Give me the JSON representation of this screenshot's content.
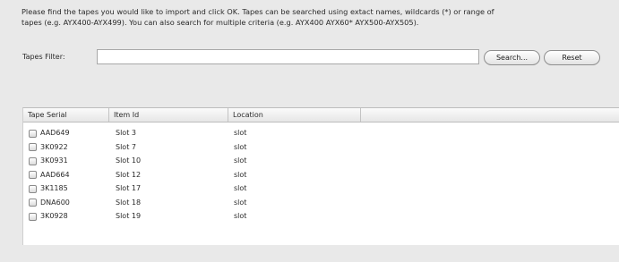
{
  "instructions": {
    "line1": "Please find the tapes you would like to import and click OK. Tapes can be searched using extact names, wildcards (*) or range of",
    "line2": "tapes (e.g. AYX400-AYX499). You can also search for multiple criteria (e.g. AYX400 AYX60* AYX500-AYX505)."
  },
  "filter": {
    "label": "Tapes Filter:",
    "value": "",
    "search_label": "Search...",
    "reset_label": "Reset"
  },
  "table": {
    "columns": [
      "Tape Serial",
      "Item Id",
      "Location",
      ""
    ],
    "rows": [
      {
        "serial": "AAD649",
        "item": "Slot 3",
        "location": "slot",
        "checked": false
      },
      {
        "serial": "3K0922",
        "item": "Slot 7",
        "location": "slot",
        "checked": false
      },
      {
        "serial": "3K0931",
        "item": "Slot 10",
        "location": "slot",
        "checked": false
      },
      {
        "serial": "AAD664",
        "item": "Slot 12",
        "location": "slot",
        "checked": false
      },
      {
        "serial": "3K1185",
        "item": "Slot 17",
        "location": "slot",
        "checked": false
      },
      {
        "serial": "DNA600",
        "item": "Slot 18",
        "location": "slot",
        "checked": false
      },
      {
        "serial": "3K0928",
        "item": "Slot 19",
        "location": "slot",
        "checked": false
      }
    ]
  }
}
